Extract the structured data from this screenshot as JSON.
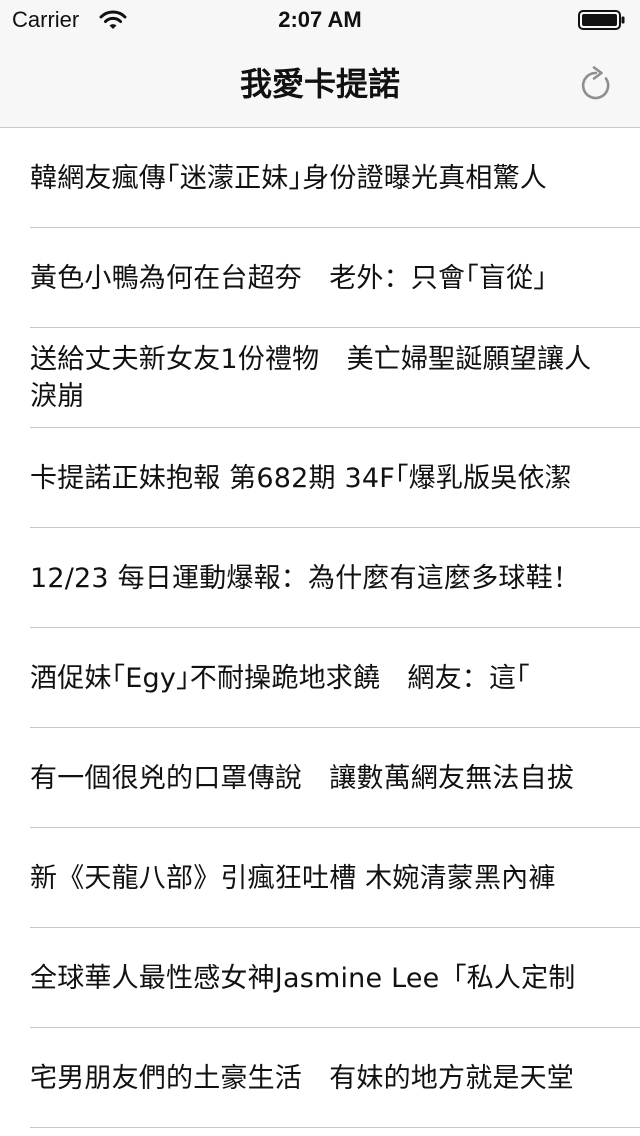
{
  "status_bar": {
    "carrier": "Carrier",
    "time": "2:07 AM"
  },
  "nav_bar": {
    "title": "我愛卡提諾",
    "refresh_icon": "refresh-icon"
  },
  "articles": [
    {
      "title": "韓網友瘋傳｢迷濛正妹｣身份證曝光真相驚人"
    },
    {
      "title": "黃色小鴨為何在台超夯　老外：只會｢盲從｣"
    },
    {
      "title": "送給丈夫新女友1份禮物　美亡婦聖誕願望讓人淚崩"
    },
    {
      "title": "卡提諾正妹抱報 第682期 34F｢爆乳版吳依潔"
    },
    {
      "title": "12/23 每日運動爆報：為什麼有這麼多球鞋！"
    },
    {
      "title": "酒促妹｢Egy｣不耐操跪地求饒　網友：這｢"
    },
    {
      "title": "有一個很兇的口罩傳說　讓數萬網友無法自拔"
    },
    {
      "title": "新《天龍八部》引瘋狂吐槽 木婉清蒙黑內褲"
    },
    {
      "title": "全球華人最性感女神Jasmine Lee「私人定制"
    },
    {
      "title": "宅男朋友們的土豪生活　有妹的地方就是天堂"
    }
  ],
  "colors": {
    "bar_background": "#f7f7f7",
    "separator": "#c8c7cc",
    "icon_gray": "#8e8e93",
    "text": "#111111"
  }
}
